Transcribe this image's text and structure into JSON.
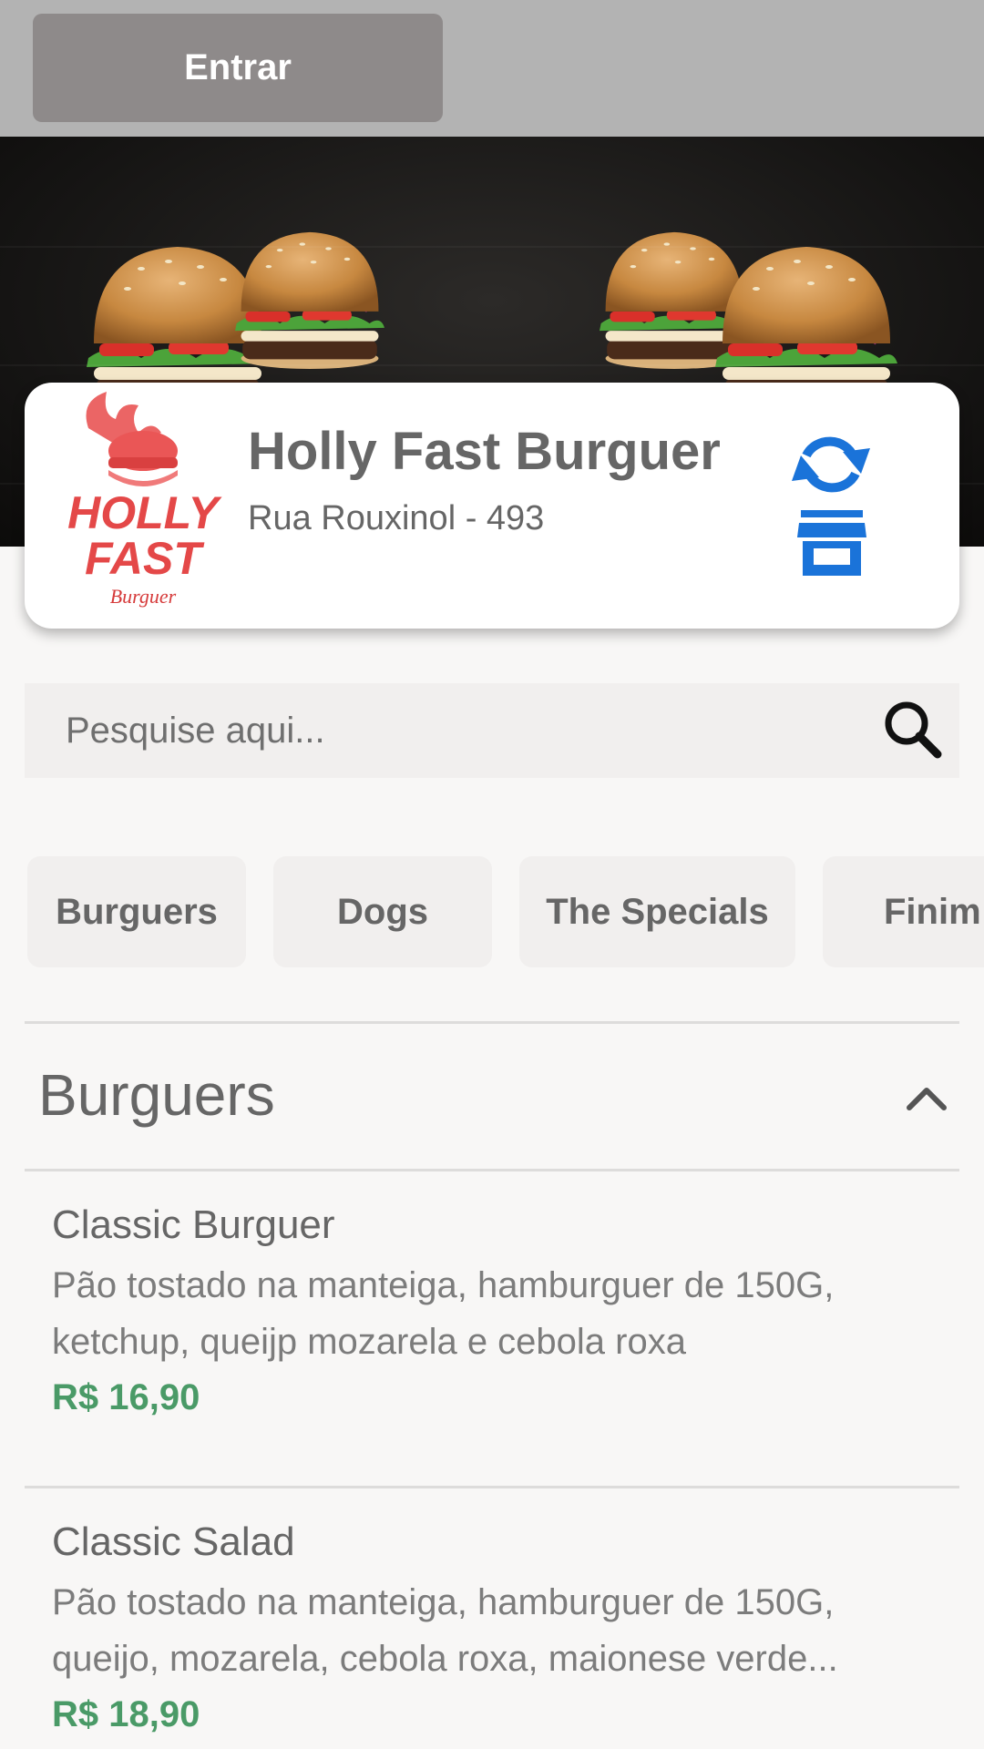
{
  "header": {
    "login_label": "Entrar"
  },
  "store": {
    "name": "Holly Fast Burguer",
    "address": "Rua Rouxinol - 493",
    "logo_text": [
      "HOLLY",
      "FAST",
      "Burguer"
    ],
    "icons": {
      "refresh": "refresh-icon",
      "store": "store-icon"
    },
    "accent_color": "#1a73d9"
  },
  "search": {
    "placeholder": "Pesquise aqui...",
    "value": "",
    "icon": "search-icon"
  },
  "categories": [
    {
      "label": "Burguers"
    },
    {
      "label": "Dogs"
    },
    {
      "label": "The Specials"
    },
    {
      "label": "Finim"
    }
  ],
  "section": {
    "title": "Burguers",
    "expanded": true,
    "toggle_icon": "chevron-up-icon"
  },
  "products": [
    {
      "name": "Classic Burguer",
      "description": "Pão tostado na manteiga, hamburguer de 150G, ketchup, queijp mozarela e cebola roxa",
      "price": "R$ 16,90"
    },
    {
      "name": "Classic Salad",
      "description": "Pão tostado na manteiga, hamburguer de 150G, queijo, mozarela, cebola roxa, maionese verde...",
      "price": "R$ 18,90"
    }
  ],
  "colors": {
    "topbar": "#b3b3b3",
    "login_button": "#8e8a8a",
    "price": "#4a9a67",
    "text": "#666666",
    "chip_bg": "#f1efee"
  }
}
